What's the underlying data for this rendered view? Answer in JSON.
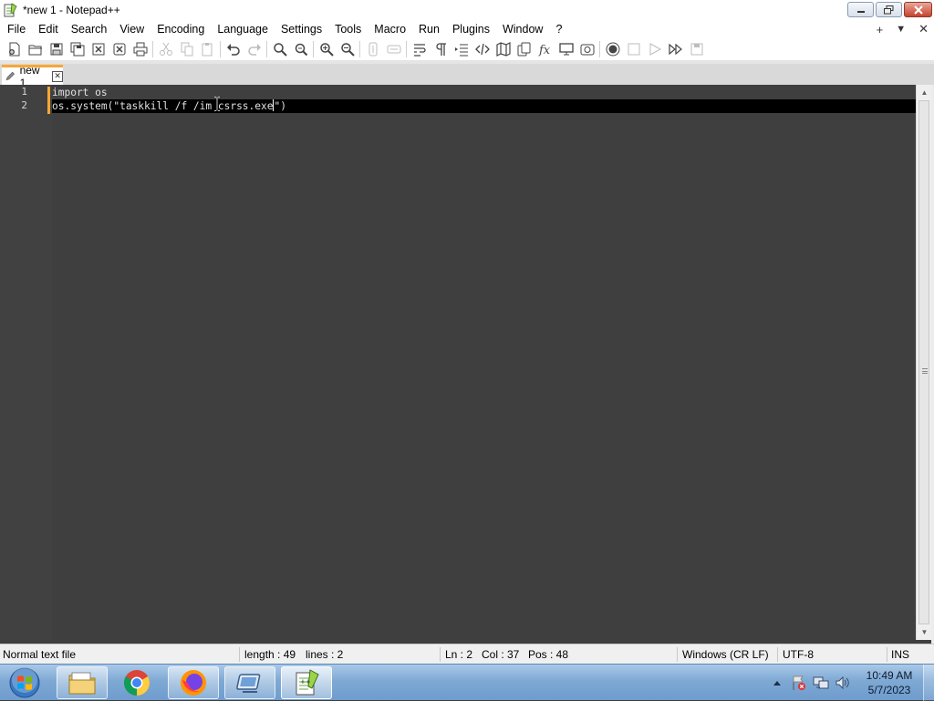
{
  "window": {
    "title": "*new 1 - Notepad++"
  },
  "menu": {
    "items": [
      "File",
      "Edit",
      "Search",
      "View",
      "Encoding",
      "Language",
      "Settings",
      "Tools",
      "Macro",
      "Run",
      "Plugins",
      "Window",
      "?"
    ],
    "right_plus": "+",
    "right_down": "▼",
    "right_close": "✕"
  },
  "toolbar": {
    "icons": [
      "new-file-icon",
      "open-file-icon",
      "save-icon",
      "save-all-icon",
      "close-icon",
      "close-all-icon",
      "print-icon",
      "cut-icon",
      "copy-icon",
      "paste-icon",
      "undo-icon",
      "redo-icon",
      "find-icon",
      "replace-icon",
      "zoom-in-icon",
      "zoom-out-icon",
      "sync-vertical-icon",
      "sync-horizontal-icon",
      "word-wrap-icon",
      "show-all-chars-icon",
      "indent-guide-icon",
      "xml-tag-icon",
      "document-map-icon",
      "clone-icon",
      "function-list-icon",
      "monitoring-icon",
      "folder-workspace-icon",
      "record-macro-icon",
      "stop-macro-icon",
      "play-macro-icon",
      "run-macro-multiple-icon",
      "save-macro-icon"
    ]
  },
  "tabs": [
    {
      "label": "new 1",
      "close": "✕"
    }
  ],
  "editor": {
    "lines": [
      {
        "number": "1",
        "text": "import os"
      },
      {
        "number": "2",
        "text_before_caret": "os.system(\"taskkill /f /im csrss.exe",
        "text_after_caret": "\")"
      }
    ]
  },
  "status": {
    "file_type": "Normal text file",
    "length": "length : 49",
    "lines": "lines : 2",
    "ln": "Ln : 2",
    "col": "Col : 37",
    "pos": "Pos : 48",
    "eol": "Windows (CR LF)",
    "encoding": "UTF-8",
    "mode": "INS"
  },
  "taskbar": {
    "apps": [
      "windows-explorer",
      "google-chrome",
      "firefox",
      "remote-desktop",
      "notepad-plus-plus"
    ],
    "clock_time": "10:49 AM",
    "clock_date": "5/7/2023"
  },
  "colors": {
    "editor_bg": "#3f3f3f",
    "current_line": "#000000",
    "tab_accent": "#f7a734",
    "change_marker": "#f7a734"
  }
}
